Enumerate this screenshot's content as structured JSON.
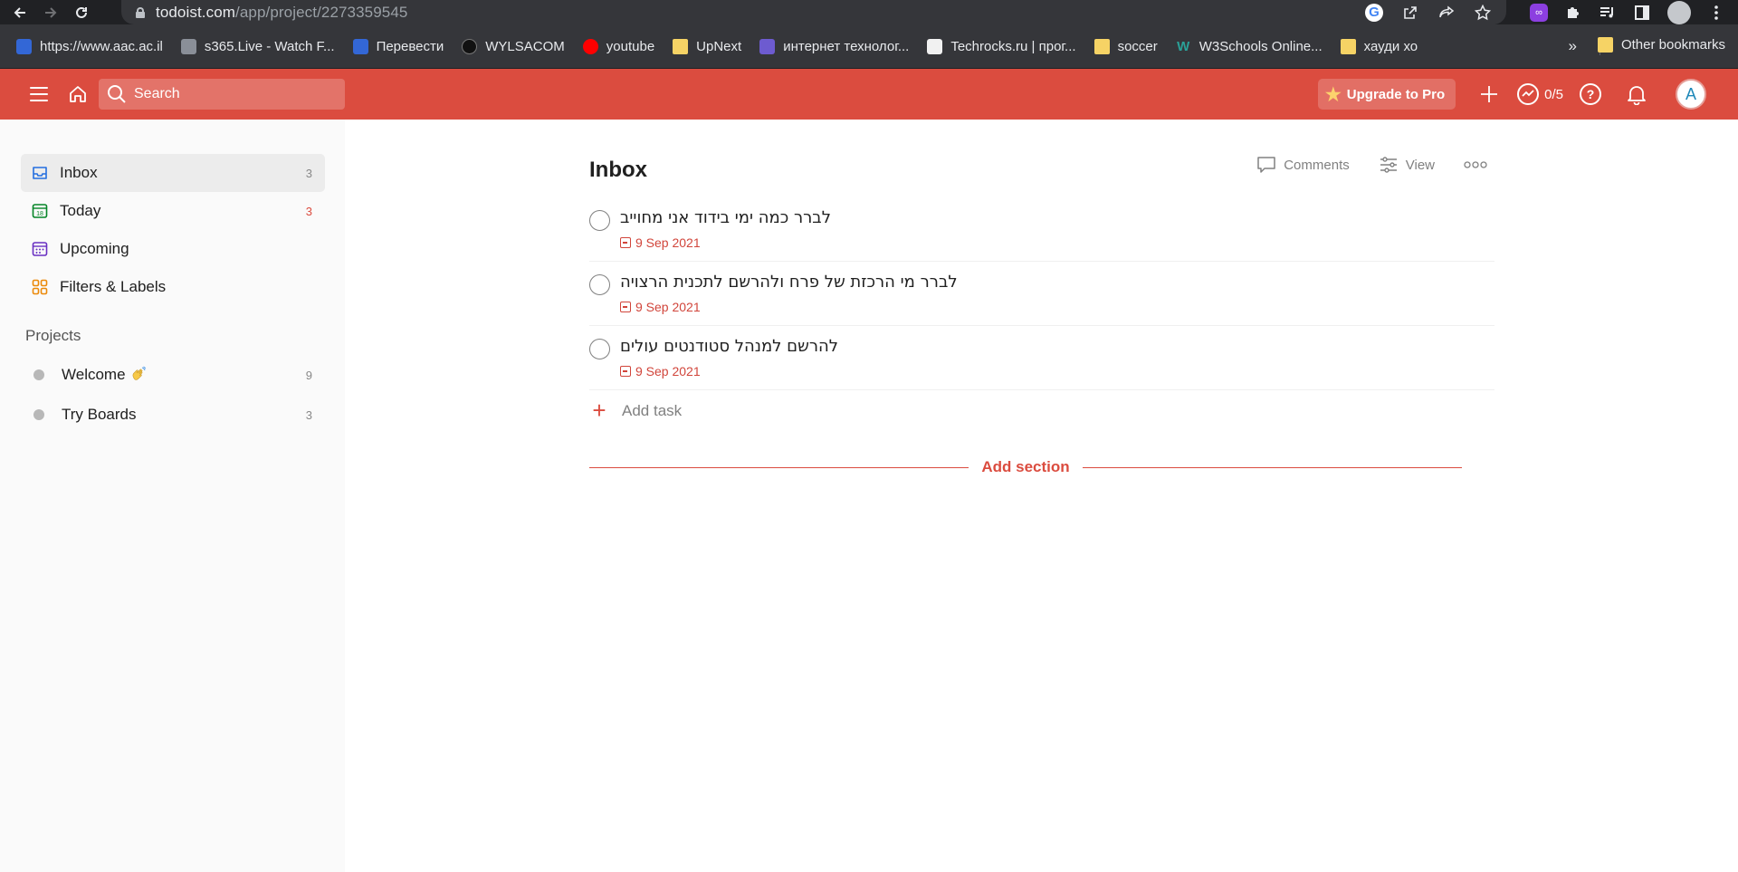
{
  "browser": {
    "url_host": "todoist.com",
    "url_path": "/app/project/2273359545",
    "bookmarks": [
      {
        "label": "https://www.aac.ac.il",
        "icon": "blue"
      },
      {
        "label": "s365.Live - Watch F...",
        "icon": "gray"
      },
      {
        "label": "Перевести",
        "icon": "blue"
      },
      {
        "label": "WYLSACOM",
        "icon": "dark"
      },
      {
        "label": "youtube",
        "icon": "yt"
      },
      {
        "label": "UpNext",
        "icon": "folder"
      },
      {
        "label": "интернет технолог...",
        "icon": "purple"
      },
      {
        "label": "Techrocks.ru | прог...",
        "icon": "white"
      },
      {
        "label": "soccer",
        "icon": "folder"
      },
      {
        "label": "W3Schools Online...",
        "icon": "green"
      },
      {
        "label": "хауди хо",
        "icon": "folder"
      }
    ],
    "more_label": "»",
    "other_bookmarks": "Other bookmarks"
  },
  "header": {
    "search_placeholder": "Search",
    "upgrade_label": "Upgrade to Pro",
    "karma": "0/5",
    "avatar_letter": "A",
    "accent_color": "#db4c3f"
  },
  "sidebar": {
    "items": [
      {
        "label": "Inbox",
        "count": "3",
        "icon": "inbox-icon"
      },
      {
        "label": "Today",
        "count": "3",
        "icon": "today-icon"
      },
      {
        "label": "Upcoming",
        "count": "",
        "icon": "upcoming-icon"
      },
      {
        "label": "Filters & Labels",
        "count": "",
        "icon": "filters-icon"
      }
    ],
    "projects_title": "Projects",
    "projects": [
      {
        "label": "Welcome",
        "count": "9"
      },
      {
        "label": "Try Boards",
        "count": "3"
      }
    ]
  },
  "main": {
    "title": "Inbox",
    "comments_label": "Comments",
    "view_label": "View",
    "tasks": [
      {
        "text": "לברר כמה ימי בידוד אני מחוייב",
        "due": "9 Sep 2021"
      },
      {
        "text": "לברר מי הרכזת של פרח ולהרשם לתכנית הרצויה",
        "due": "9 Sep 2021"
      },
      {
        "text": "להרשם למנהל סטודנטים עולים",
        "due": "9 Sep 2021"
      }
    ],
    "add_task_label": "Add task",
    "add_section_label": "Add section"
  }
}
